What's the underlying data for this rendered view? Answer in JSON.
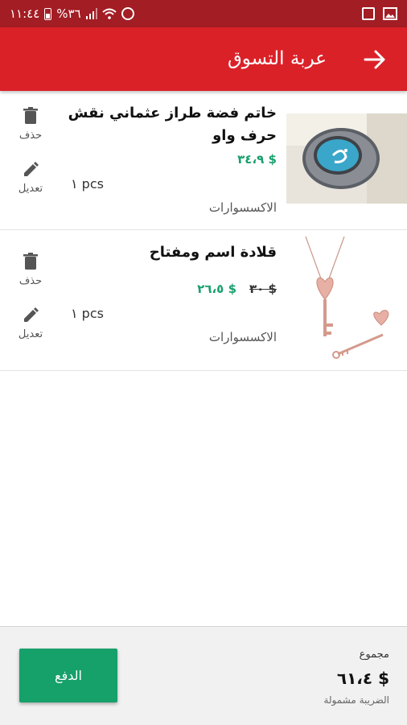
{
  "status_bar": {
    "time": "١١:٤٤",
    "battery_percent": "%٣٦"
  },
  "header": {
    "title": "عربة التسوق",
    "back_icon": "arrow-right-icon"
  },
  "cart_items": [
    {
      "name": "خاتم  فضة طراز عثماني نقش حرف واو",
      "old_price": "",
      "price": "$ ٣٤،٩",
      "quantity": "١ pcs",
      "category": "الاكسسوارات",
      "delete_label": "حذف",
      "edit_label": "تعديل",
      "image": "silver-ring-turquoise-image"
    },
    {
      "name": "قلادة اسم ومفتاح",
      "old_price": "$ ٣٠",
      "price": "$ ٢٦،٥",
      "quantity": "١ pcs",
      "category": "الاكسسوارات",
      "delete_label": "حذف",
      "edit_label": "تعديل",
      "image": "heart-key-necklace-image"
    }
  ],
  "footer": {
    "pay_label": "الدفع",
    "total_label": "مجموع",
    "total_value": "$ ٦١،٤",
    "tax_note": "الضريبة مشمولة"
  },
  "colors": {
    "status_bar": "#a31d24",
    "app_bar": "#db2128",
    "price_green": "#1aa06d",
    "pay_button": "#16a06a"
  }
}
